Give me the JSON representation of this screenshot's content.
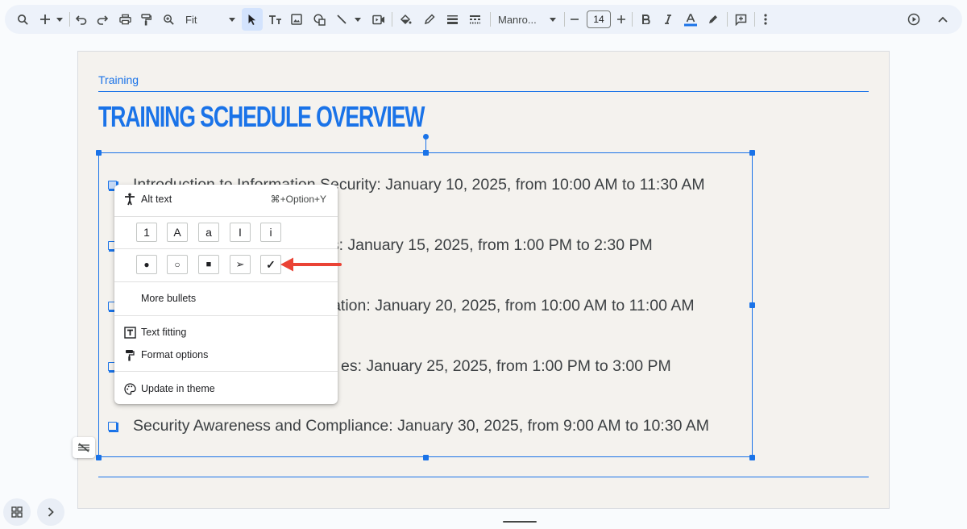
{
  "toolbar": {
    "zoom_value": "Fit",
    "font_name": "Manro...",
    "font_size": "14"
  },
  "slide": {
    "label": "Training",
    "title": "TRAINING SCHEDULE OVERVIEW",
    "bullets": [
      "Introduction to Information Security: January 10, 2025, from 10:00 AM to 11:30 AM",
      "es: January 15, 2025, from 1:00 PM to 2:30 PM",
      "ication: January 20, 2025, from 10:00 AM to 11:00 AM",
      "es: January 25, 2025, from 1:00 PM to 3:00 PM",
      "Security Awareness and Compliance: January 30, 2025, from 9:00 AM to 10:30 AM"
    ]
  },
  "context_menu": {
    "alt_text": "Alt text",
    "alt_text_shortcut": "⌘+Option+Y",
    "numbered_options": [
      "1",
      "A",
      "a",
      "I",
      "i"
    ],
    "bullet_options": [
      "●",
      "○",
      "■",
      "➢",
      "✓"
    ],
    "more_bullets": "More bullets",
    "text_fitting": "Text fitting",
    "format_options": "Format options",
    "update_in_theme": "Update in theme"
  },
  "colors": {
    "accent": "#1a73e8",
    "arrow": "#ea4335"
  }
}
